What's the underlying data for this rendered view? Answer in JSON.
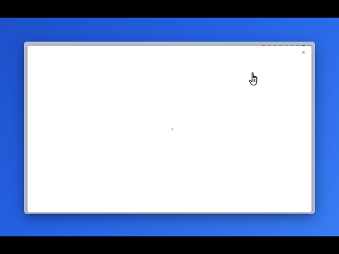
{
  "modal": {
    "close_label": "×"
  },
  "colors": {
    "desktop": "#2563e4",
    "modal_background": "#ffffff",
    "toolbar_accent": "#c14e8b"
  },
  "icons": {
    "close": "close-icon",
    "cursor": "hand-pointer-cursor-icon",
    "loading": "loading-indicator-icon"
  }
}
